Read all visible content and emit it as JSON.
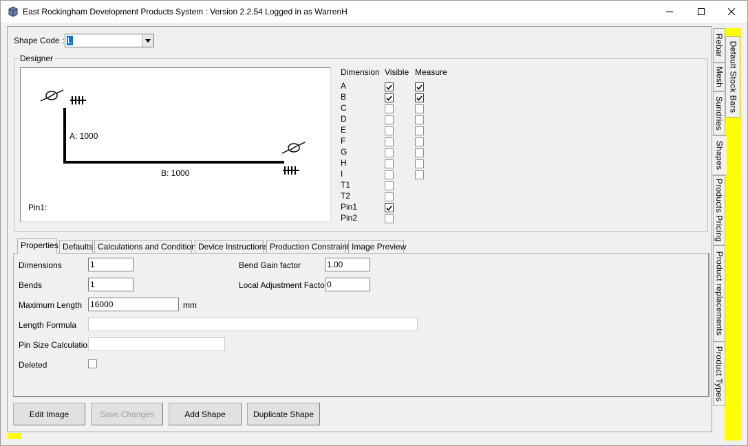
{
  "window": {
    "title": "East Rockingham Development Products System : Version 2.2.54 Logged in as WarrenH"
  },
  "shape_code": {
    "label": "Shape Code :",
    "value": "L"
  },
  "designer": {
    "title": "Designer",
    "label_a": "A: 1000",
    "label_b": "B: 1000",
    "label_pin": "Pin1:",
    "columns": {
      "dimension": "Dimension",
      "visible": "Visible",
      "measure": "Measure"
    },
    "rows": [
      {
        "name": "A",
        "visible": true,
        "measure": true
      },
      {
        "name": "B",
        "visible": true,
        "measure": true
      },
      {
        "name": "C",
        "visible": false,
        "measure": false
      },
      {
        "name": "D",
        "visible": false,
        "measure": false
      },
      {
        "name": "E",
        "visible": false,
        "measure": false
      },
      {
        "name": "F",
        "visible": false,
        "measure": false
      },
      {
        "name": "G",
        "visible": false,
        "measure": false
      },
      {
        "name": "H",
        "visible": false,
        "measure": false
      },
      {
        "name": "I",
        "visible": false,
        "measure": false
      },
      {
        "name": "T1",
        "visible": false,
        "measure": null
      },
      {
        "name": "T2",
        "visible": false,
        "measure": null
      },
      {
        "name": "Pin1",
        "visible": true,
        "measure": null
      },
      {
        "name": "Pin2",
        "visible": false,
        "measure": null
      }
    ]
  },
  "tabs": [
    {
      "label": "Properties",
      "active": true
    },
    {
      "label": "Defaults",
      "active": false
    },
    {
      "label": "Calculations and Conditions",
      "active": false
    },
    {
      "label": "Device Instructions",
      "active": false
    },
    {
      "label": "Production Constraints",
      "active": false
    },
    {
      "label": "Image Preview",
      "active": false
    }
  ],
  "properties": {
    "dimensions_label": "Dimensions",
    "dimensions_value": "1",
    "bends_label": "Bends",
    "bends_value": "1",
    "max_length_label": "Maximum Length",
    "max_length_value": "16000",
    "max_length_unit": "mm",
    "length_formula_label": "Length Formula",
    "length_formula_value": "",
    "pin_size_label": "Pin Size Calculation",
    "pin_size_value": "",
    "deleted_label": "Deleted",
    "deleted_checked": false,
    "bend_gain_label": "Bend Gain factor",
    "bend_gain_value": "1.00",
    "local_adj_label": "Local Adjustment Factor",
    "local_adj_value": "0"
  },
  "buttons": {
    "edit_image": "Edit Image",
    "save_changes": "Save Changes",
    "add_shape": "Add Shape",
    "duplicate_shape": "Duplicate Shape"
  },
  "side_tabs": {
    "rebar": "Rebar",
    "mesh": "Mesh",
    "sundries": "Sundries",
    "shapes": "Shapes",
    "products_pricing": "Products Pricing",
    "product_replacements": "Product replacements",
    "product_types": "Product Types",
    "default_stock_bars": "Default Stock Bars"
  },
  "colors": {
    "highlight": "#ffff00",
    "selection": "#0078d7"
  }
}
